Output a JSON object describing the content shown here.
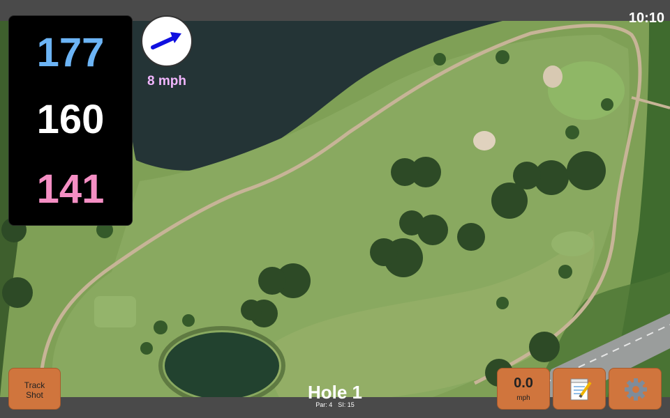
{
  "status": {
    "time": "10:10"
  },
  "distances": {
    "back": "177",
    "middle": "160",
    "front": "141"
  },
  "wind": {
    "speed": "8 mph",
    "icon": "wind-arrow-icon"
  },
  "hole": {
    "title": "Hole 1",
    "par": "Par: 4",
    "si": "SI: 15"
  },
  "buttons": {
    "track_line1": "Track",
    "track_line2": "Shot",
    "speed_value": "0.0",
    "speed_unit": "mph",
    "notes_icon": "notepad-icon",
    "settings_icon": "gear-icon"
  },
  "colors": {
    "back_distance": "#6cb4f5",
    "middle_distance": "#ffffff",
    "front_distance": "#f58fc4",
    "wind_text": "#f2b6ff",
    "button_bg": "#d0753d",
    "wind_arrow": "#1010e0"
  }
}
